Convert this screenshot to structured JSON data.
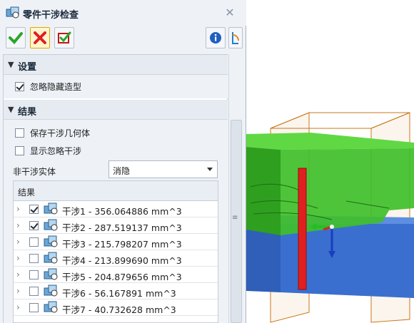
{
  "window": {
    "title": "零件干涉检查",
    "icon": "interference-check-icon",
    "close_icon": "close-icon"
  },
  "toolbar": {
    "ok_icon": "check-icon",
    "cancel_icon": "x-icon",
    "apply_icon": "apply-check-icon",
    "info_icon": "info-icon",
    "pin_icon": "pin-icon"
  },
  "settings": {
    "header": "设置",
    "ignore_hidden_label": "忽略隐藏造型",
    "ignore_hidden_checked": true
  },
  "results_section": {
    "header": "结果",
    "save_geometry_label": "保存干涉几何体",
    "save_geometry_checked": false,
    "show_ignored_label": "显示忽略干涉",
    "show_ignored_checked": false,
    "non_interference_label": "非干涉实体",
    "non_interference_value": "消隐",
    "list_header": "结果",
    "items": [
      {
        "label": "干涉1 - 356.064886 mm^3",
        "checked": true
      },
      {
        "label": "干涉2 - 287.519137 mm^3",
        "checked": true
      },
      {
        "label": "干涉3 - 215.798207 mm^3",
        "checked": false
      },
      {
        "label": "干涉4 - 213.899690 mm^3",
        "checked": false
      },
      {
        "label": "干涉5 - 204.879656 mm^3",
        "checked": false
      },
      {
        "label": "干涉6 - 56.167891 mm^3",
        "checked": false
      },
      {
        "label": "干涉7 - 40.732628 mm^3",
        "checked": false
      }
    ]
  },
  "colors": {
    "green_body": "#3fbf2a",
    "blue_body": "#3a6fd0",
    "red_interference": "#e02020",
    "bbox_lines": "#c8781e"
  }
}
